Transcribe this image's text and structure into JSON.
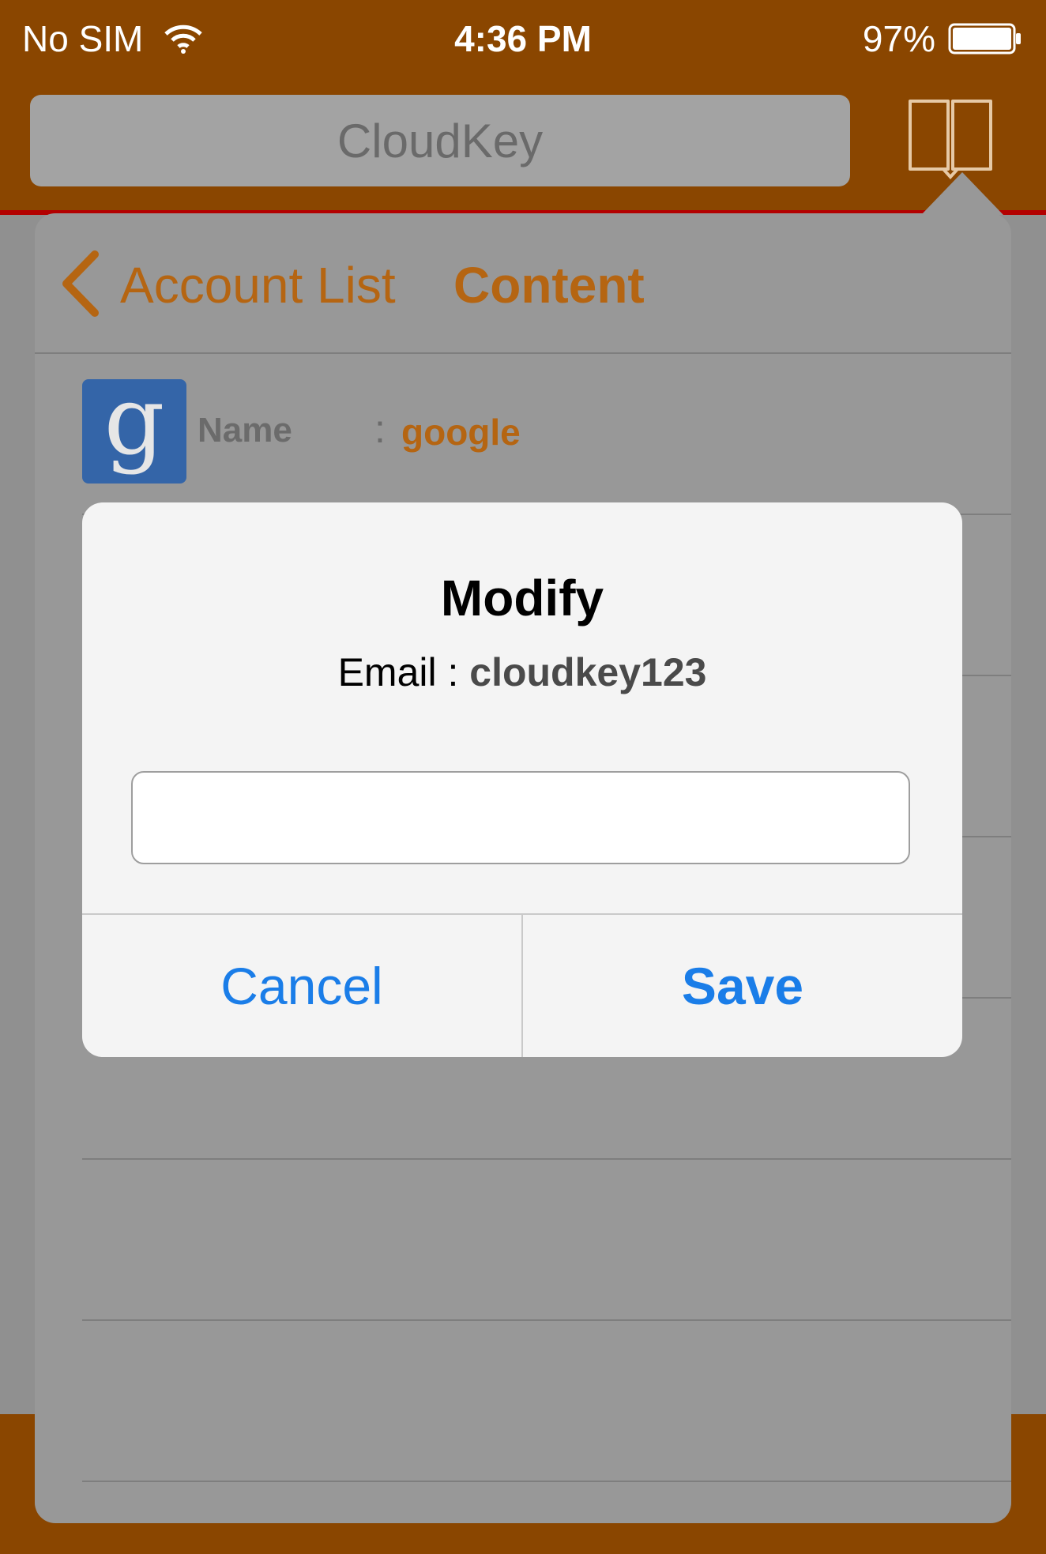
{
  "status_bar": {
    "carrier": "No SIM",
    "time": "4:36 PM",
    "battery": "97%"
  },
  "nav_bar": {
    "search_text": "CloudKey"
  },
  "popover": {
    "back_label": "Account List",
    "title": "Content",
    "account": {
      "name_label": "Name",
      "colon": ":",
      "name_value": "google",
      "logo_letter": "g"
    }
  },
  "alert": {
    "title": "Modify",
    "message_label": "Email : ",
    "message_value": "cloudkey123",
    "input_value": "",
    "cancel_label": "Cancel",
    "save_label": "Save"
  },
  "colors": {
    "brand": "#8a4600",
    "accent": "#b56512",
    "button_blue": "#1a7de8"
  }
}
